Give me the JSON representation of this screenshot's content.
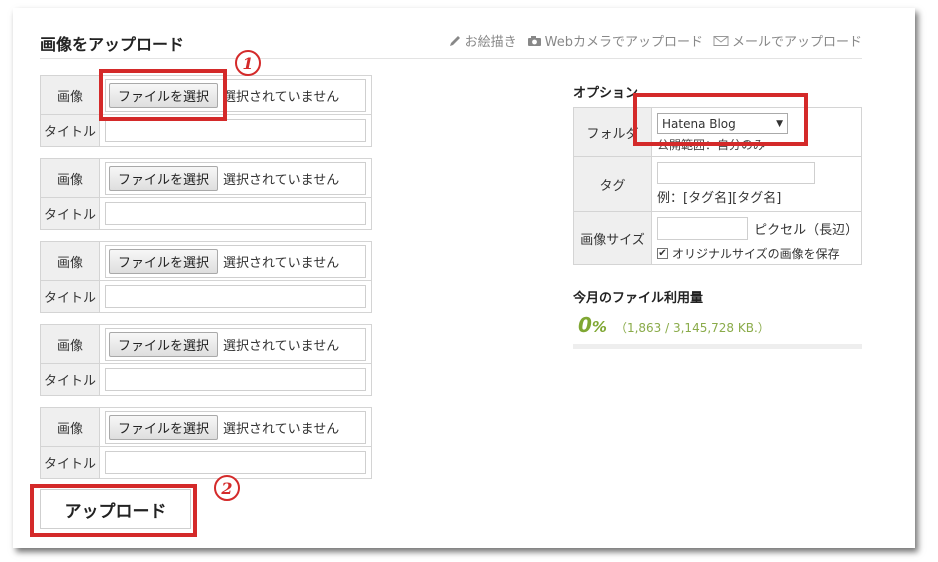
{
  "header": {
    "title": "画像をアップロード",
    "links": [
      {
        "icon": "pencil-icon",
        "label": "お絵描き"
      },
      {
        "icon": "camera-icon",
        "label": "Webカメラでアップロード"
      },
      {
        "icon": "mail-icon",
        "label": "メールでアップロード"
      }
    ]
  },
  "upload": {
    "image_label": "画像",
    "title_label": "タイトル",
    "file_button": "ファイルを選択",
    "file_status": "選択されていません",
    "rows": 5,
    "submit": "アップロード"
  },
  "annotations": {
    "one": "1",
    "two": "2",
    "color": "#d42a2a"
  },
  "options": {
    "title": "オプション",
    "folder_label": "フォルダ",
    "folder_value": "Hatena Blog",
    "folder_scope": "公開範囲：自分のみ",
    "tag_label": "タグ",
    "tag_example": "例：[タグ名][タグ名]",
    "size_label": "画像サイズ",
    "size_unit": "ピクセル（長辺）",
    "keep_original": "オリジナルサイズの画像を保存",
    "keep_original_checked": true
  },
  "usage": {
    "title": "今月のファイル利用量",
    "percent_num": "0",
    "percent_sign": "%",
    "detail": "（1,863 / 3,145,728 KB.）",
    "accent": "#7fa733"
  }
}
